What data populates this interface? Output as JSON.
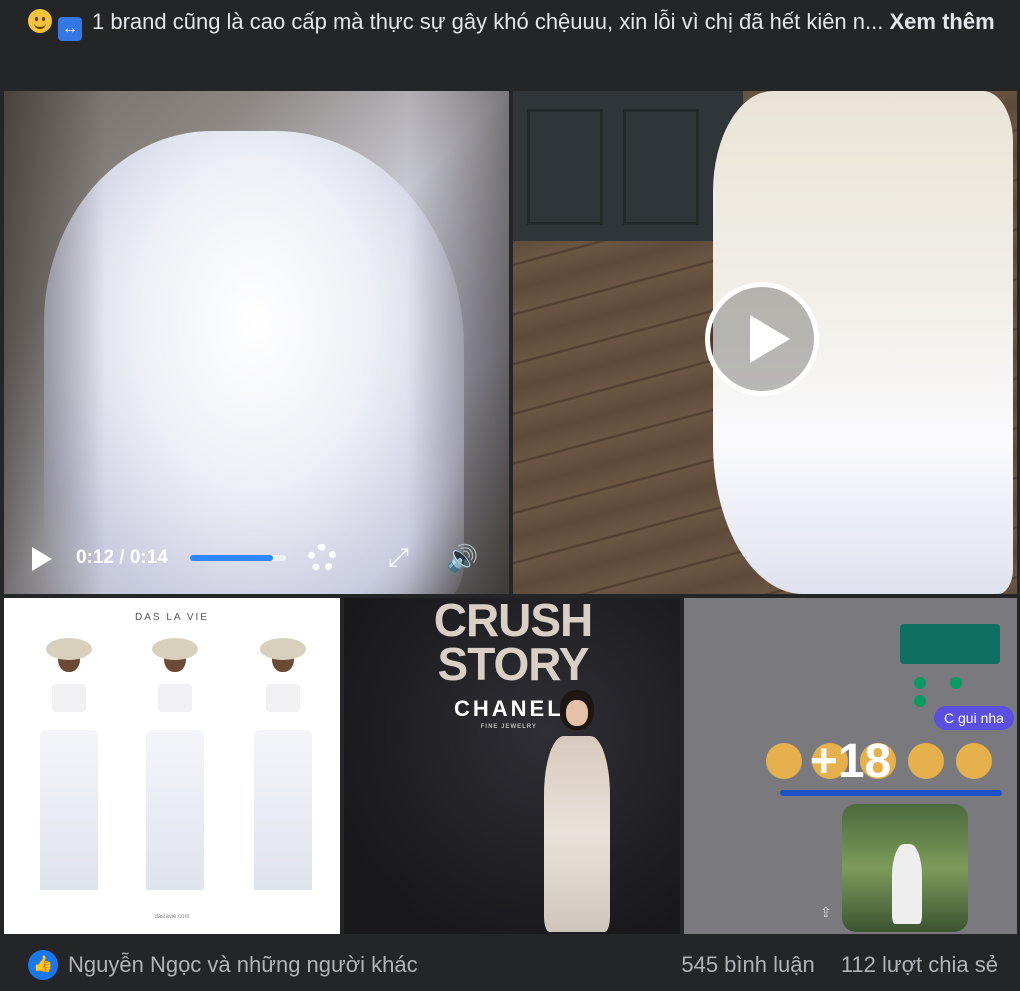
{
  "post": {
    "caption": "1 brand cũng là cao cấp mà thực sự gây khó chệuuu, xin lỗi vì chị đã hết kiên n...",
    "see_more": "Xem thêm",
    "caption_icons": [
      "slightly-smiling-face-icon",
      "left-right-arrow-icon"
    ]
  },
  "video": {
    "time": "0:12 / 0:14",
    "progress": 0.86
  },
  "photo1": {
    "brand": "DAS LA VIE",
    "footer": "daslavie.com"
  },
  "photo2": {
    "headline": "CRUSH STORY",
    "logo": "CHANEL",
    "sub": "FINE JEWELRY"
  },
  "photo3": {
    "chat_bubble": "C gui nha",
    "more_count": "+18"
  },
  "footer": {
    "reactions_text": "Nguyễn Ngọc và những người khác",
    "comments": "545 bình luận",
    "shares": "112 lượt chia sẻ"
  },
  "colors": {
    "background": "#242526",
    "text": "#e4e6eb",
    "muted": "#b0b3b8",
    "accent": "#1877f2"
  }
}
